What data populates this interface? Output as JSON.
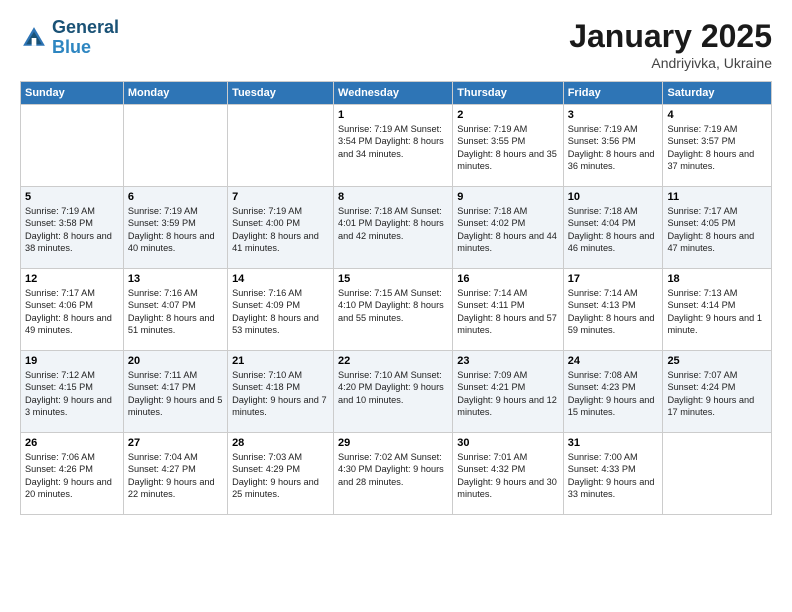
{
  "logo": {
    "line1": "General",
    "line2": "Blue"
  },
  "title": "January 2025",
  "subtitle": "Andriyivka, Ukraine",
  "days_header": [
    "Sunday",
    "Monday",
    "Tuesday",
    "Wednesday",
    "Thursday",
    "Friday",
    "Saturday"
  ],
  "weeks": [
    [
      {
        "day": "",
        "content": ""
      },
      {
        "day": "",
        "content": ""
      },
      {
        "day": "",
        "content": ""
      },
      {
        "day": "1",
        "content": "Sunrise: 7:19 AM\nSunset: 3:54 PM\nDaylight: 8 hours\nand 34 minutes."
      },
      {
        "day": "2",
        "content": "Sunrise: 7:19 AM\nSunset: 3:55 PM\nDaylight: 8 hours\nand 35 minutes."
      },
      {
        "day": "3",
        "content": "Sunrise: 7:19 AM\nSunset: 3:56 PM\nDaylight: 8 hours\nand 36 minutes."
      },
      {
        "day": "4",
        "content": "Sunrise: 7:19 AM\nSunset: 3:57 PM\nDaylight: 8 hours\nand 37 minutes."
      }
    ],
    [
      {
        "day": "5",
        "content": "Sunrise: 7:19 AM\nSunset: 3:58 PM\nDaylight: 8 hours\nand 38 minutes."
      },
      {
        "day": "6",
        "content": "Sunrise: 7:19 AM\nSunset: 3:59 PM\nDaylight: 8 hours\nand 40 minutes."
      },
      {
        "day": "7",
        "content": "Sunrise: 7:19 AM\nSunset: 4:00 PM\nDaylight: 8 hours\nand 41 minutes."
      },
      {
        "day": "8",
        "content": "Sunrise: 7:18 AM\nSunset: 4:01 PM\nDaylight: 8 hours\nand 42 minutes."
      },
      {
        "day": "9",
        "content": "Sunrise: 7:18 AM\nSunset: 4:02 PM\nDaylight: 8 hours\nand 44 minutes."
      },
      {
        "day": "10",
        "content": "Sunrise: 7:18 AM\nSunset: 4:04 PM\nDaylight: 8 hours\nand 46 minutes."
      },
      {
        "day": "11",
        "content": "Sunrise: 7:17 AM\nSunset: 4:05 PM\nDaylight: 8 hours\nand 47 minutes."
      }
    ],
    [
      {
        "day": "12",
        "content": "Sunrise: 7:17 AM\nSunset: 4:06 PM\nDaylight: 8 hours\nand 49 minutes."
      },
      {
        "day": "13",
        "content": "Sunrise: 7:16 AM\nSunset: 4:07 PM\nDaylight: 8 hours\nand 51 minutes."
      },
      {
        "day": "14",
        "content": "Sunrise: 7:16 AM\nSunset: 4:09 PM\nDaylight: 8 hours\nand 53 minutes."
      },
      {
        "day": "15",
        "content": "Sunrise: 7:15 AM\nSunset: 4:10 PM\nDaylight: 8 hours\nand 55 minutes."
      },
      {
        "day": "16",
        "content": "Sunrise: 7:14 AM\nSunset: 4:11 PM\nDaylight: 8 hours\nand 57 minutes."
      },
      {
        "day": "17",
        "content": "Sunrise: 7:14 AM\nSunset: 4:13 PM\nDaylight: 8 hours\nand 59 minutes."
      },
      {
        "day": "18",
        "content": "Sunrise: 7:13 AM\nSunset: 4:14 PM\nDaylight: 9 hours\nand 1 minute."
      }
    ],
    [
      {
        "day": "19",
        "content": "Sunrise: 7:12 AM\nSunset: 4:15 PM\nDaylight: 9 hours\nand 3 minutes."
      },
      {
        "day": "20",
        "content": "Sunrise: 7:11 AM\nSunset: 4:17 PM\nDaylight: 9 hours\nand 5 minutes."
      },
      {
        "day": "21",
        "content": "Sunrise: 7:10 AM\nSunset: 4:18 PM\nDaylight: 9 hours\nand 7 minutes."
      },
      {
        "day": "22",
        "content": "Sunrise: 7:10 AM\nSunset: 4:20 PM\nDaylight: 9 hours\nand 10 minutes."
      },
      {
        "day": "23",
        "content": "Sunrise: 7:09 AM\nSunset: 4:21 PM\nDaylight: 9 hours\nand 12 minutes."
      },
      {
        "day": "24",
        "content": "Sunrise: 7:08 AM\nSunset: 4:23 PM\nDaylight: 9 hours\nand 15 minutes."
      },
      {
        "day": "25",
        "content": "Sunrise: 7:07 AM\nSunset: 4:24 PM\nDaylight: 9 hours\nand 17 minutes."
      }
    ],
    [
      {
        "day": "26",
        "content": "Sunrise: 7:06 AM\nSunset: 4:26 PM\nDaylight: 9 hours\nand 20 minutes."
      },
      {
        "day": "27",
        "content": "Sunrise: 7:04 AM\nSunset: 4:27 PM\nDaylight: 9 hours\nand 22 minutes."
      },
      {
        "day": "28",
        "content": "Sunrise: 7:03 AM\nSunset: 4:29 PM\nDaylight: 9 hours\nand 25 minutes."
      },
      {
        "day": "29",
        "content": "Sunrise: 7:02 AM\nSunset: 4:30 PM\nDaylight: 9 hours\nand 28 minutes."
      },
      {
        "day": "30",
        "content": "Sunrise: 7:01 AM\nSunset: 4:32 PM\nDaylight: 9 hours\nand 30 minutes."
      },
      {
        "day": "31",
        "content": "Sunrise: 7:00 AM\nSunset: 4:33 PM\nDaylight: 9 hours\nand 33 minutes."
      },
      {
        "day": "",
        "content": ""
      }
    ]
  ]
}
